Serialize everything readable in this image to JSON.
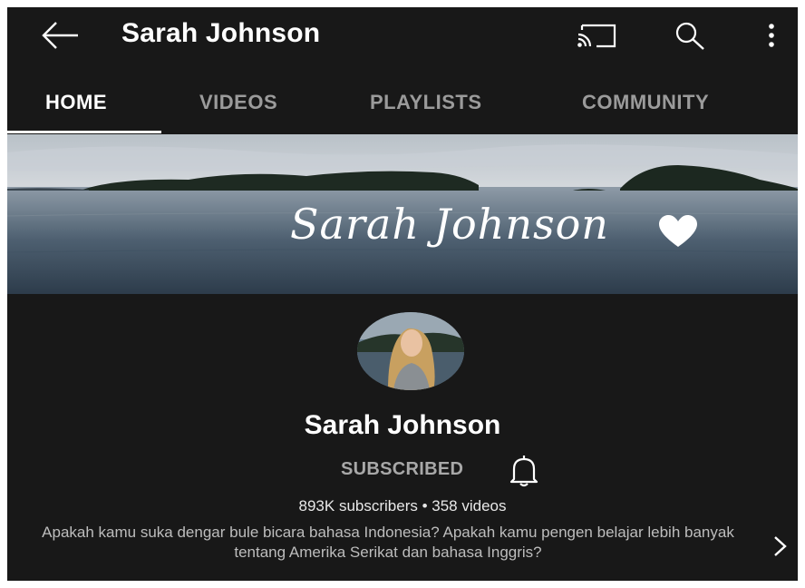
{
  "header": {
    "title": "Sarah Johnson",
    "icons": [
      "back-arrow-icon",
      "cast-icon",
      "search-icon",
      "more-vert-icon"
    ]
  },
  "tabs": [
    {
      "label": "HOME",
      "active": true
    },
    {
      "label": "VIDEOS",
      "active": false
    },
    {
      "label": "PLAYLISTS",
      "active": false
    },
    {
      "label": "COMMUNITY",
      "active": false
    }
  ],
  "banner": {
    "text": "Sarah Johnson",
    "icon": "heart-icon"
  },
  "channel": {
    "name": "Sarah Johnson",
    "subscribe_label": "SUBSCRIBED",
    "stats": "893K subscribers • 358 videos",
    "description": "Apakah kamu suka dengar bule bicara bahasa Indonesia? Apakah kamu pengen belajar lebih banyak tentang Amerika Serikat dan bahasa Inggris?"
  },
  "colors": {
    "background": "#181818",
    "text": "#ffffff",
    "inactive_tab": "#9b9b9b",
    "muted": "#a8a8a8"
  }
}
